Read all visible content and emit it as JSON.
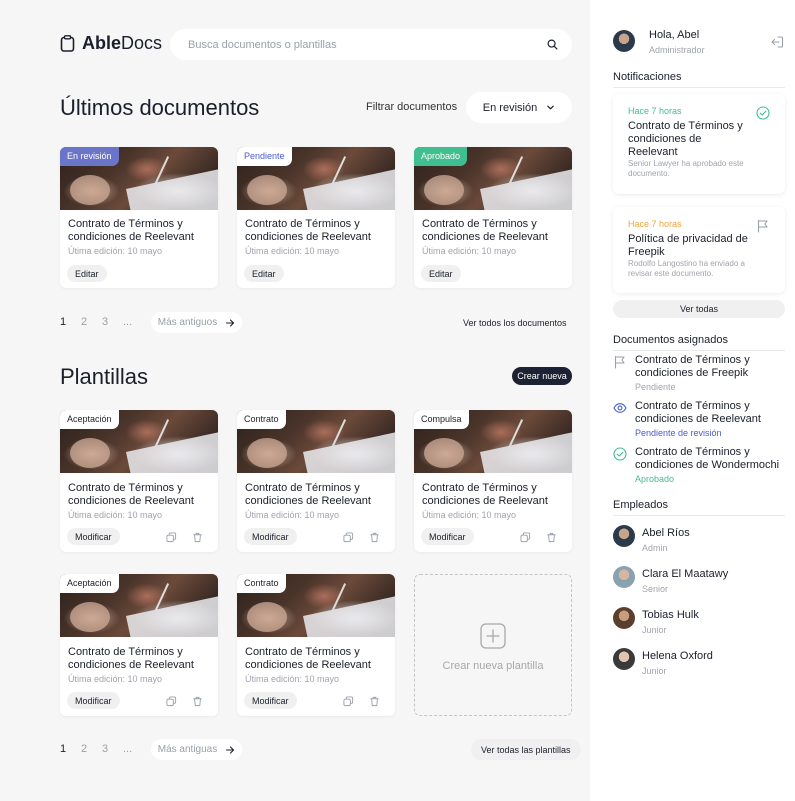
{
  "brand": {
    "name_bold": "Able",
    "name_rest": "Docs"
  },
  "search": {
    "placeholder": "Busca documentos o plantillas"
  },
  "documents": {
    "title": "Últimos documentos",
    "filter_label": "Filtrar documentos",
    "filter_value": "En revisión",
    "cards": [
      {
        "status": "En revisión",
        "status_bg": "#6a75c9",
        "status_color": "#ffffff",
        "title": "Contrato de Términos y condiciones de Reelevant",
        "date": "Útima edición: 10 mayo",
        "action": "Editar"
      },
      {
        "status": "Pendiente",
        "status_bg": "#ffffff",
        "status_color": "#4a5bd0",
        "title": "Contrato de Términos y condiciones de Reelevant",
        "date": "Útima edición: 10 mayo",
        "action": "Editar"
      },
      {
        "status": "Aprobado",
        "status_bg": "#3fbf8f",
        "status_color": "#ffffff",
        "title": "Contrato de Términos y condiciones de Reelevant",
        "date": "Útima edición: 10 mayo",
        "action": "Editar"
      }
    ],
    "pager": {
      "pages": [
        "1",
        "2",
        "3",
        "..."
      ],
      "older": "Más antiguos",
      "view_all": "Ver todos los documentos"
    }
  },
  "templates": {
    "title": "Plantillas",
    "create_label": "Crear nueva",
    "cards": [
      {
        "tag": "Aceptación",
        "title": "Contrato de Términos y condiciones de Reelevant",
        "date": "Útima edición: 10 mayo",
        "action": "Modificar"
      },
      {
        "tag": "Contrato",
        "title": "Contrato de Términos y condiciones de Reelevant",
        "date": "Útima edición: 10 mayo",
        "action": "Modificar"
      },
      {
        "tag": "Compulsa",
        "title": "Contrato de Términos y condiciones de Reelevant",
        "date": "Útima edición: 10 mayo",
        "action": "Modificar"
      },
      {
        "tag": "Aceptación",
        "title": "Contrato de Términos y condiciones de Reelevant",
        "date": "Útima edición: 10 mayo",
        "action": "Modificar"
      },
      {
        "tag": "Contrato",
        "title": "Contrato de Términos y condiciones de Reelevant",
        "date": "Útima edición: 10 mayo",
        "action": "Modificar"
      }
    ],
    "new_template": "Crear nueva plantilla",
    "pager": {
      "pages": [
        "1",
        "2",
        "3",
        "..."
      ],
      "older": "Más antiguas",
      "view_all": "Ver todas las plantillas"
    }
  },
  "user": {
    "greeting": "Hola, Abel",
    "role": "Administrador"
  },
  "notifications": {
    "title": "Notificaciones",
    "items": [
      {
        "time": "Hace 7 horas",
        "time_color": "#3fbf8f",
        "title": "Contrato de Términos y condiciones de Reelevant",
        "desc": "Senior Lawyer ha aprobado este documento.",
        "icon": "check-circle-icon"
      },
      {
        "time": "Hace 7 horas",
        "time_color": "#f0a43a",
        "title": "Política de privacidad de Freepik",
        "desc": "Rodolfo Langostino ha enviado a revisar este documento.",
        "icon": "flag-icon"
      }
    ],
    "see_all": "Ver todas"
  },
  "assigned": {
    "title": "Documentos asignados",
    "items": [
      {
        "title": "Contrato de Términos y condiciones de Freepik",
        "status": "Pendiente",
        "status_color": "#a0a4ac",
        "icon": "flag-icon"
      },
      {
        "title": "Contrato de Términos y condiciones de Reelevant",
        "status": "Pendiente de revisión",
        "status_color": "#4a5bd0",
        "icon": "eye-icon"
      },
      {
        "title": "Contrato de Términos y condiciones de Wondermochi",
        "status": "Aprobado",
        "status_color": "#3fbf8f",
        "icon": "check-circle-icon"
      }
    ]
  },
  "employees": {
    "title": "Empleados",
    "items": [
      {
        "name": "Abel Ríos",
        "role": "Admin"
      },
      {
        "name": "Clara El Maatawy",
        "role": "Senior"
      },
      {
        "name": "Tobias Hulk",
        "role": "Junior"
      },
      {
        "name": "Helena Oxford",
        "role": "Junior"
      }
    ]
  }
}
